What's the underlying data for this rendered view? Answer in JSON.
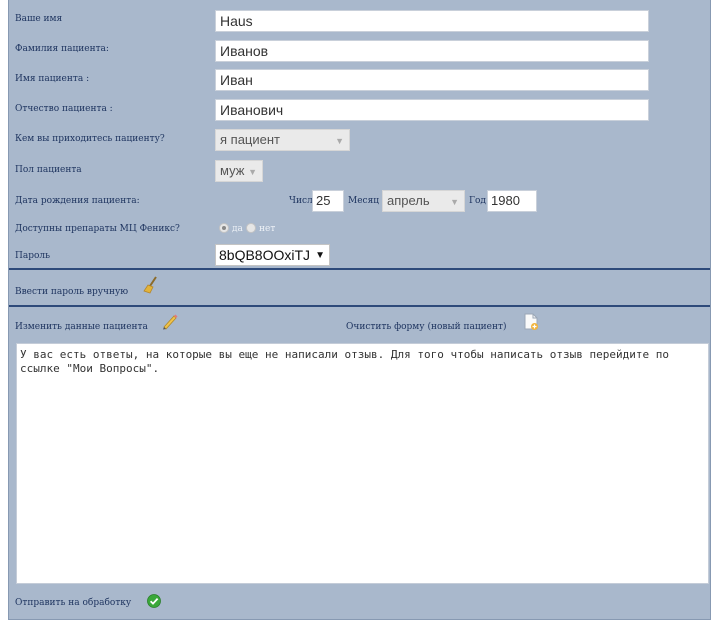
{
  "form": {
    "your_name_label": "Ваше имя",
    "your_name_value": "Haus",
    "surname_label": "Фамилия пациента:",
    "surname_value": "Иванов",
    "first_name_label": "Имя пациента :",
    "first_name_value": "Иван",
    "patronymic_label": "Отчество пациента :",
    "patronymic_value": "Иванович",
    "relation_label": "Кем вы приходитесь пациенту?",
    "relation_value": "я пациент",
    "sex_label": "Пол пациента",
    "sex_value": "муж",
    "birthdate_label": "Дата рождения пациента:",
    "day_label": "Число",
    "day_value": "25",
    "month_label": "Месяц",
    "month_value": "апрель",
    "year_label": "Год",
    "year_value": "1980",
    "drugs_label": "Доступны препараты МЦ Феникс?",
    "drugs_yes": "да",
    "drugs_no": "нет",
    "password_label": "Пароль",
    "password_value": "8bQB8OOxiTJ"
  },
  "actions": {
    "manual_password": "Ввести пароль вручную",
    "edit_patient": "Изменить данные пациента",
    "clear_form": "Очистить форму (новый пациент)",
    "submit": "Отправить на обработку"
  },
  "message": "У вас есть ответы, на которые вы еще не написали отзыв. Для того чтобы написать отзыв перейдите по ссылке \"Мои Вопросы\".",
  "icons": {
    "manual_password": "broom-icon",
    "edit_patient": "pencil-icon",
    "clear_form": "new-document-icon",
    "submit": "green-check-icon"
  },
  "colors": {
    "panel_bg": "#a9b8cc",
    "label_text": "#1f3560",
    "separator": "#2e4a7a"
  }
}
